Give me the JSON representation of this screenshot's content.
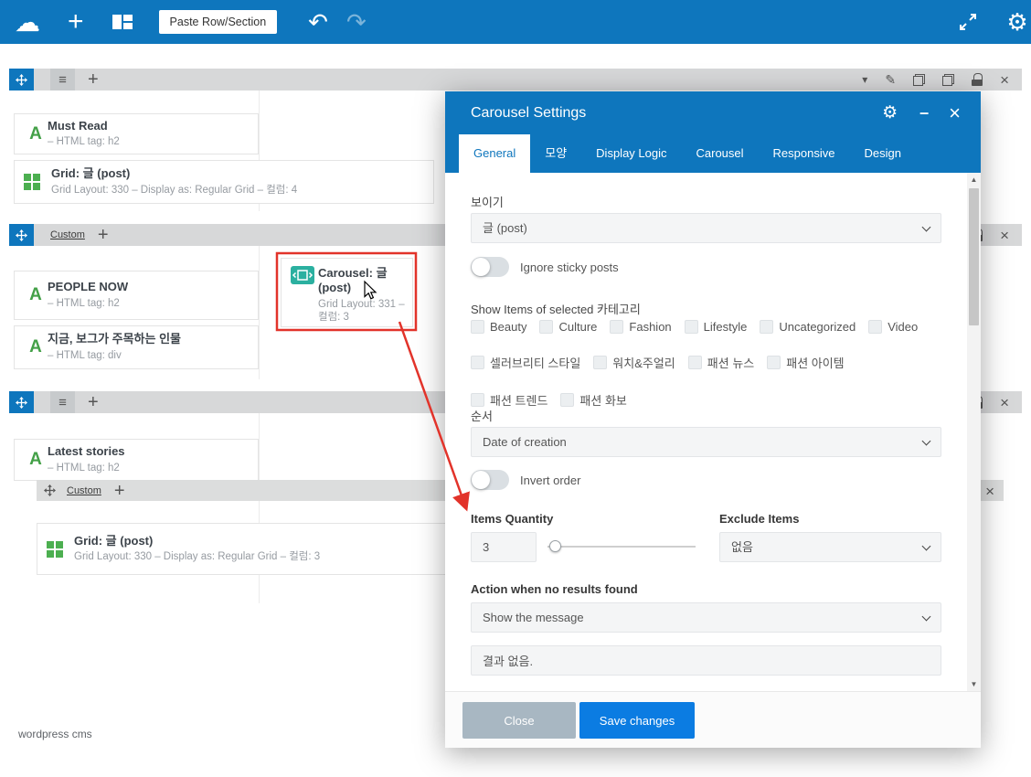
{
  "icons": {
    "cloud": "☁",
    "plus": "+",
    "undo": "↶",
    "redo": "↷",
    "hamburger": "≡",
    "caret_down": "▾",
    "pencil": "✎",
    "close": "×",
    "gear": "⚙",
    "minimize": "–",
    "scroll_up": "▲",
    "scroll_down": "▼",
    "letter_a": "A"
  },
  "toolbar": {
    "paste_button": "Paste Row/Section"
  },
  "canvas": {
    "sections": [
      {
        "elements": [
          {
            "icon": "text-element-icon",
            "title": "Must Read",
            "subtitle": "– HTML tag: h2"
          },
          {
            "icon": "grid-element-icon",
            "title": "Grid: 글 (post)",
            "subtitle": "Grid Layout: 330 – Display as: Regular Grid – 컬럼: 4"
          }
        ]
      },
      {
        "custom_label": "Custom",
        "elements": [
          {
            "icon": "text-element-icon",
            "title": "PEOPLE NOW",
            "subtitle": "– HTML tag: h2"
          },
          {
            "icon": "text-element-icon",
            "title": "지금, 보그가 주목하는 인물",
            "subtitle": "– HTML tag: div"
          },
          {
            "icon": "carousel-element-icon",
            "title": "Carousel: 글 (post)",
            "subtitle": "Grid Layout: 331 – 컬럼: 3"
          }
        ]
      },
      {
        "custom_label": "Custom",
        "elements": [
          {
            "icon": "text-element-icon",
            "title": "Latest stories",
            "subtitle": "– HTML tag: h2"
          },
          {
            "icon": "grid-element-icon",
            "title": "Grid: 글 (post)",
            "subtitle": "Grid Layout: 330 – Display as: Regular Grid – 컬럼: 3"
          }
        ]
      }
    ],
    "footer_note": "wordpress cms"
  },
  "modal": {
    "title": "Carousel Settings",
    "tabs": [
      {
        "label": "General",
        "active": true
      },
      {
        "label": "모양",
        "active": false
      },
      {
        "label": "Display Logic",
        "active": false
      },
      {
        "label": "Carousel",
        "active": false
      },
      {
        "label": "Responsive",
        "active": false
      },
      {
        "label": "Design",
        "active": false
      }
    ],
    "form": {
      "visibility": {
        "label": "보이기",
        "value": "글 (post)"
      },
      "sticky_posts": {
        "label": "Ignore sticky posts",
        "on": false
      },
      "categories": {
        "label": "Show Items of selected 카테고리",
        "options": [
          "Beauty",
          "Culture",
          "Fashion",
          "Lifestyle",
          "Uncategorized",
          "Video",
          "셀러브리티 스타일",
          "워치&주얼리",
          "패션 뉴스",
          "패션 아이템",
          "패션 트렌드",
          "패션 화보"
        ]
      },
      "order": {
        "label": "순서",
        "value": "Date of creation"
      },
      "invert_order": {
        "label": "Invert order",
        "on": false
      },
      "items_quantity": {
        "label": "Items Quantity",
        "value": "3"
      },
      "exclude_items": {
        "label": "Exclude Items",
        "value": "없음"
      },
      "no_results": {
        "label": "Action when no results found",
        "value": "Show the message",
        "message": "결과 없음."
      }
    },
    "footer": {
      "close": "Close",
      "save": "Save changes"
    }
  }
}
